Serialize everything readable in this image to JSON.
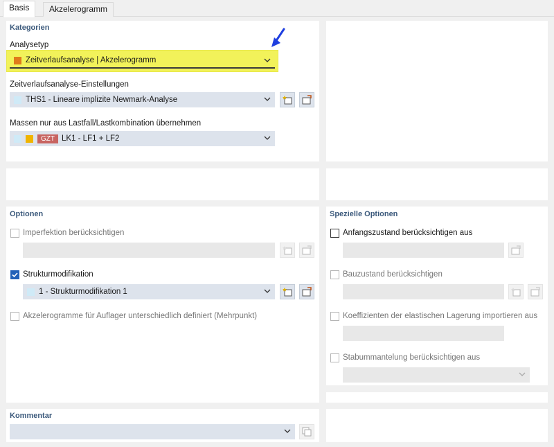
{
  "tabs": [
    {
      "label": "Basis",
      "active": true
    },
    {
      "label": "Akzelerogramm",
      "active": false
    }
  ],
  "kategorien": {
    "title": "Kategorien",
    "analysetyp": {
      "label": "Analysetyp",
      "value": "Zeitverlaufsanalyse | Akzelerogramm",
      "swatch_color": "#e07b1a"
    },
    "einstellungen": {
      "label": "Zeitverlaufsanalyse-Einstellungen",
      "value": "THS1 - Lineare implizite Newmark-Analyse",
      "swatch_color": "#cfeaf7"
    },
    "massen": {
      "label": "Massen nur aus Lastfall/Lastkombination übernehmen",
      "badge": "GZT",
      "value": "LK1 - LF1 + LF2",
      "swatch_colors": [
        "#cfeaf7",
        "#f0b400"
      ]
    }
  },
  "optionen": {
    "title": "Optionen",
    "imperfektion": {
      "label": "Imperfektion berücksichtigen",
      "checked": false,
      "enabled": false
    },
    "strukturmodifikation": {
      "label": "Strukturmodifikation",
      "checked": true,
      "enabled": true,
      "value": "1 - Strukturmodifikation 1",
      "swatch_color": "#cfeaf7"
    },
    "akzelerogramme": {
      "label": "Akzelerogramme für Auflager unterschiedlich definiert (Mehrpunkt)",
      "checked": false,
      "enabled": false
    }
  },
  "spezielle_optionen": {
    "title": "Spezielle Optionen",
    "anfangszustand": {
      "label": "Anfangszustand berücksichtigen aus",
      "checked": false,
      "enabled": true
    },
    "bauzustand": {
      "label": "Bauzustand berücksichtigen",
      "checked": false,
      "enabled": false
    },
    "koeffizienten": {
      "label": "Koeffizienten der elastischen Lagerung importieren aus",
      "checked": false,
      "enabled": false
    },
    "stabummantelung": {
      "label": "Stabummantelung berücksichtigen aus",
      "checked": false,
      "enabled": false
    }
  },
  "kommentar": {
    "title": "Kommentar",
    "value": ""
  },
  "colors": {
    "section_title": "#3c5a7c",
    "highlight": "#f2f25a",
    "annotation_arrow": "#1f3fe0",
    "checkbox_checked": "#2261b8"
  }
}
